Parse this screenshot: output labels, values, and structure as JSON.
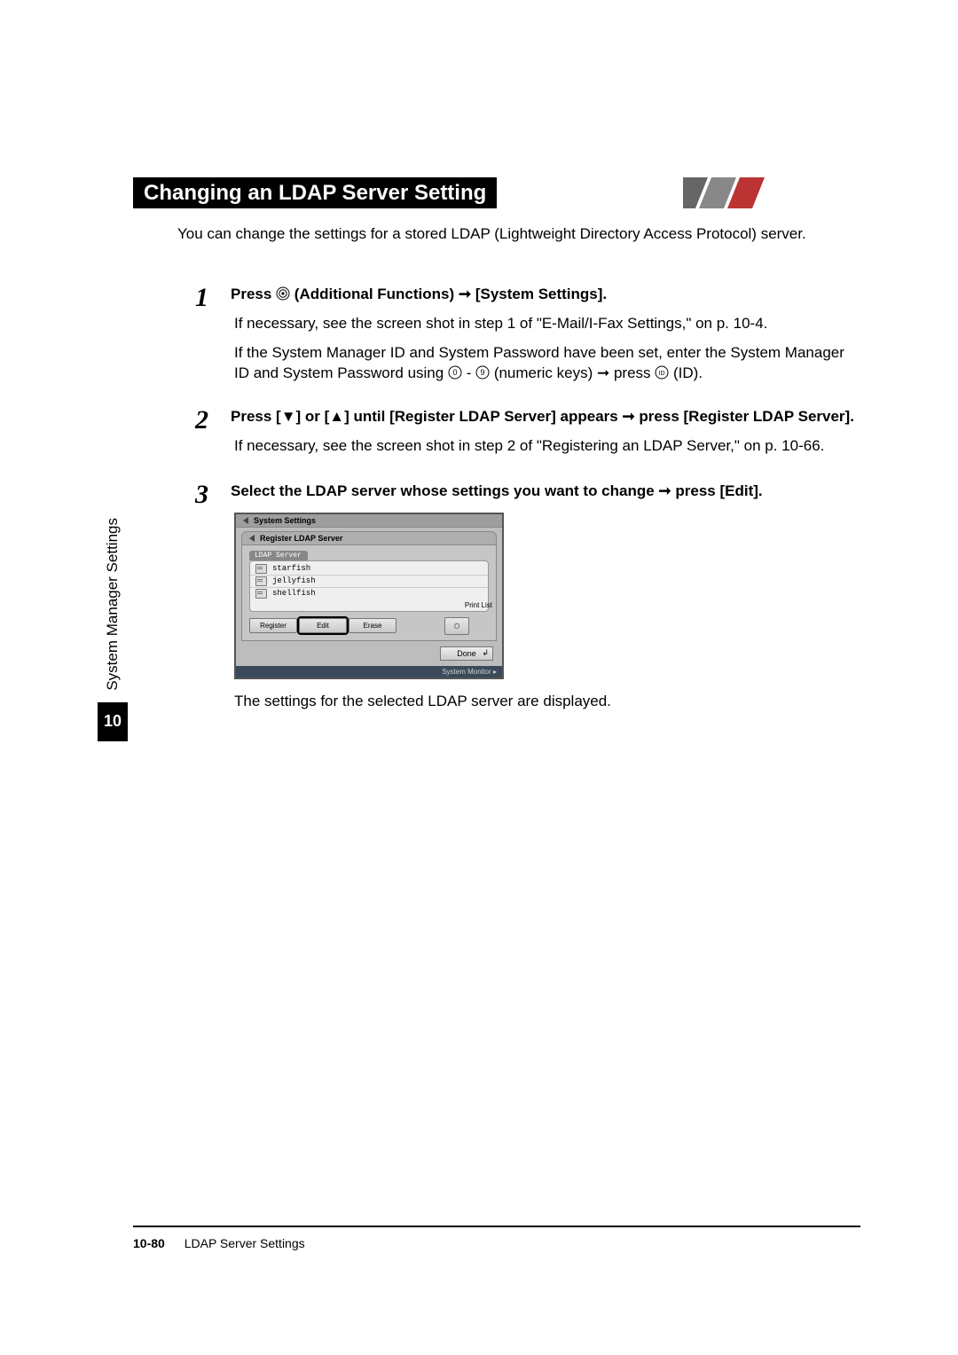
{
  "chapter": {
    "number": "10",
    "sideLabel": "System Manager Settings"
  },
  "heading": "Changing an LDAP Server Setting",
  "intro": "You can change the settings for a stored LDAP (Lightweight Directory Access Protocol) server.",
  "steps": {
    "s1": {
      "num": "1",
      "heading_a": "Press ",
      "heading_b": " (Additional Functions) ➞ [System Settings].",
      "p1": "If necessary, see the screen shot in step 1 of \"E-Mail/I-Fax Settings,\" on p. 10-4.",
      "p2a": "If the System Manager ID and System Password have been set, enter the System Manager ID and System Password using ",
      "p2b": " - ",
      "p2c": " (numeric keys) ➞ press ",
      "p2d": " (ID)."
    },
    "s2": {
      "num": "2",
      "heading": "Press [▼] or [▲] until [Register LDAP Server] appears ➞ press [Register LDAP Server].",
      "p1": "If necessary, see the screen shot in step 2 of \"Registering an LDAP Server,\" on p. 10-66."
    },
    "s3": {
      "num": "3",
      "heading": "Select the LDAP server whose settings you want to change ➞ press [Edit].",
      "after": "The settings for the selected LDAP server are displayed."
    }
  },
  "device": {
    "title": "System Settings",
    "subtitle": "Register LDAP Server",
    "listHeader": "LDAP Server",
    "rows": [
      "starfish",
      "jellyfish",
      "shellfish"
    ],
    "buttons": {
      "register": "Register",
      "edit": "Edit",
      "erase": "Erase"
    },
    "printList": "Print List",
    "done": "Done",
    "sysMonitor": "System Monitor  ▸"
  },
  "footer": {
    "page": "10-80",
    "section": "LDAP Server Settings"
  }
}
